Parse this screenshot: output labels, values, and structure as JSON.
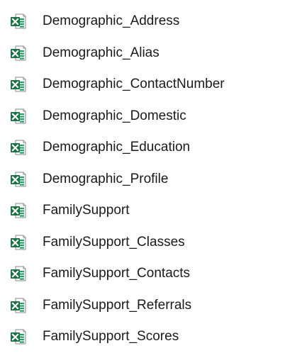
{
  "files": [
    {
      "name": "Demographic_Address",
      "icon": "excel-file-icon"
    },
    {
      "name": "Demographic_Alias",
      "icon": "excel-file-icon"
    },
    {
      "name": "Demographic_ContactNumber",
      "icon": "excel-file-icon"
    },
    {
      "name": "Demographic_Domestic",
      "icon": "excel-file-icon"
    },
    {
      "name": "Demographic_Education",
      "icon": "excel-file-icon"
    },
    {
      "name": "Demographic_Profile",
      "icon": "excel-file-icon"
    },
    {
      "name": "FamilySupport",
      "icon": "excel-file-icon"
    },
    {
      "name": "FamilySupport_Classes",
      "icon": "excel-file-icon"
    },
    {
      "name": "FamilySupport_Contacts",
      "icon": "excel-file-icon"
    },
    {
      "name": "FamilySupport_Referrals",
      "icon": "excel-file-icon"
    },
    {
      "name": "FamilySupport_Scores",
      "icon": "excel-file-icon"
    }
  ],
  "colors": {
    "excel_green": "#1d7044",
    "excel_light": "#21a366",
    "text": "#1a1a1a"
  }
}
